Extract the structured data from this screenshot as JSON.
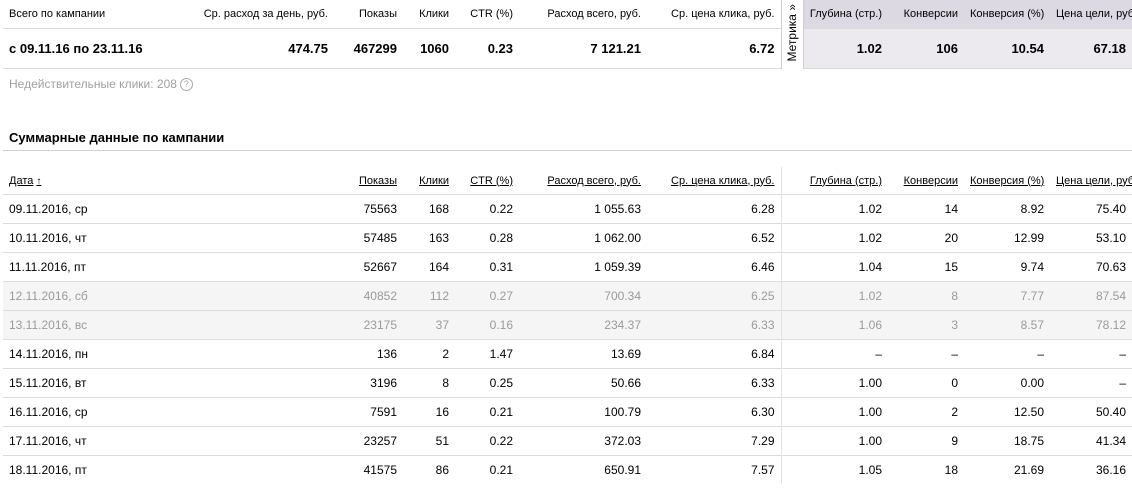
{
  "summary": {
    "headers": {
      "total": "Всего по кампании",
      "avg_daily_spend": "Ср. расход за день, руб.",
      "impressions": "Показы",
      "clicks": "Клики",
      "ctr": "CTR (%)",
      "spend_total": "Расход всего, руб.",
      "avg_cpc": "Ср. цена клика, руб.",
      "depth": "Глубина (стр.)",
      "conversions": "Конверсии",
      "conversion_rate": "Конверсия (%)",
      "goal_cost": "Цена цели, руб."
    },
    "row": {
      "period": "с 09.11.16 по 23.11.16",
      "avg_daily_spend": "474.75",
      "impressions": "467299",
      "clicks": "1060",
      "ctr": "0.23",
      "spend_total": "7 121.21",
      "avg_cpc": "6.72",
      "depth": "1.02",
      "conversions": "106",
      "conversion_rate": "10.54",
      "goal_cost": "67.18"
    },
    "metrika_tab": "Метрика »"
  },
  "invalid_clicks": "Недействительные клики: 208",
  "invalid_help_icon": "?",
  "section_title": "Суммарные данные по кампании",
  "daily": {
    "headers": {
      "date": "Дата",
      "sort_arrow": "↑",
      "impressions": "Показы",
      "clicks": "Клики",
      "ctr": "CTR (%)",
      "spend_total": "Расход всего, руб.",
      "avg_cpc": "Ср. цена клика, руб.",
      "depth": "Глубина (стр.)",
      "conversions": "Конверсии",
      "conversion_rate": "Конверсия (%)",
      "goal_cost": "Цена цели, руб."
    },
    "rows": [
      {
        "date": "09.11.2016, ср",
        "impressions": "75563",
        "clicks": "168",
        "ctr": "0.22",
        "spend": "1 055.63",
        "cpc": "6.28",
        "depth": "1.02",
        "conv": "14",
        "conv_rate": "8.92",
        "goal_cost": "75.40",
        "dim": false
      },
      {
        "date": "10.11.2016, чт",
        "impressions": "57485",
        "clicks": "163",
        "ctr": "0.28",
        "spend": "1 062.00",
        "cpc": "6.52",
        "depth": "1.02",
        "conv": "20",
        "conv_rate": "12.99",
        "goal_cost": "53.10",
        "dim": false
      },
      {
        "date": "11.11.2016, пт",
        "impressions": "52667",
        "clicks": "164",
        "ctr": "0.31",
        "spend": "1 059.39",
        "cpc": "6.46",
        "depth": "1.04",
        "conv": "15",
        "conv_rate": "9.74",
        "goal_cost": "70.63",
        "dim": false
      },
      {
        "date": "12.11.2016, сб",
        "impressions": "40852",
        "clicks": "112",
        "ctr": "0.27",
        "spend": "700.34",
        "cpc": "6.25",
        "depth": "1.02",
        "conv": "8",
        "conv_rate": "7.77",
        "goal_cost": "87.54",
        "dim": true
      },
      {
        "date": "13.11.2016, вс",
        "impressions": "23175",
        "clicks": "37",
        "ctr": "0.16",
        "spend": "234.37",
        "cpc": "6.33",
        "depth": "1.06",
        "conv": "3",
        "conv_rate": "8.57",
        "goal_cost": "78.12",
        "dim": true
      },
      {
        "date": "14.11.2016, пн",
        "impressions": "136",
        "clicks": "2",
        "ctr": "1.47",
        "spend": "13.69",
        "cpc": "6.84",
        "depth": "–",
        "conv": "–",
        "conv_rate": "–",
        "goal_cost": "–",
        "dim": false
      },
      {
        "date": "15.11.2016, вт",
        "impressions": "3196",
        "clicks": "8",
        "ctr": "0.25",
        "spend": "50.66",
        "cpc": "6.33",
        "depth": "1.00",
        "conv": "0",
        "conv_rate": "0.00",
        "goal_cost": "–",
        "dim": false
      },
      {
        "date": "16.11.2016, ср",
        "impressions": "7591",
        "clicks": "16",
        "ctr": "0.21",
        "spend": "100.79",
        "cpc": "6.30",
        "depth": "1.00",
        "conv": "2",
        "conv_rate": "12.50",
        "goal_cost": "50.40",
        "dim": false
      },
      {
        "date": "17.11.2016, чт",
        "impressions": "23257",
        "clicks": "51",
        "ctr": "0.22",
        "spend": "372.03",
        "cpc": "7.29",
        "depth": "1.00",
        "conv": "9",
        "conv_rate": "18.75",
        "goal_cost": "41.34",
        "dim": false
      },
      {
        "date": "18.11.2016, пт",
        "impressions": "41575",
        "clicks": "86",
        "ctr": "0.21",
        "spend": "650.91",
        "cpc": "7.57",
        "depth": "1.05",
        "conv": "18",
        "conv_rate": "21.69",
        "goal_cost": "36.16",
        "dim": false
      }
    ]
  }
}
